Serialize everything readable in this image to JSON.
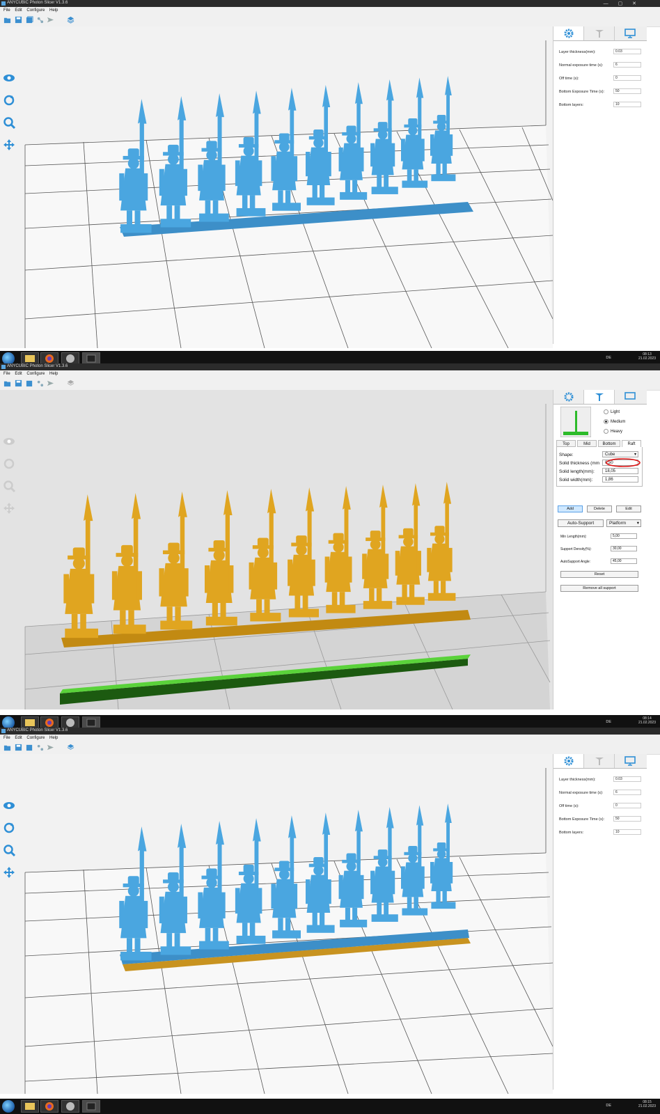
{
  "app": {
    "title": "ANYCUBIC Photon Slicer V1.3.6",
    "menus": [
      "File",
      "Edit",
      "Configure",
      "Help"
    ]
  },
  "panel1": {
    "settings": [
      {
        "label": "Layer thickness(mm):",
        "value": "0.03"
      },
      {
        "label": "Normal exposure time (s):",
        "value": "6"
      },
      {
        "label": "Off time (s):",
        "value": "0"
      },
      {
        "label": "Bottom Exposure Time (s):",
        "value": "50"
      },
      {
        "label": "Bottom layers:",
        "value": "10"
      }
    ]
  },
  "panel2": {
    "density": [
      "Light",
      "Medium",
      "Heavy"
    ],
    "tabs": [
      "Top",
      "Mid",
      "Bottom",
      "Raft"
    ],
    "shape_label": "Shape:",
    "shape_value": "Cube",
    "solid_thickness_label": "Solid thickness (mm",
    "solid_thickness_value": "0,50",
    "solid_length_label": "Solid length(mm):",
    "solid_length_value": "18,05",
    "solid_width_label": "Solid width(mm):",
    "solid_width_value": "1,86",
    "add": "Add",
    "delete": "Delete",
    "edit": "Edit",
    "auto_support": "Auto-Support",
    "platform": "Platform",
    "min_length_label": "Min Length(mm):",
    "min_length_value": "5,00",
    "support_density_label": "Support Density(%):",
    "support_density_value": "30,00",
    "autosupport_angle_label": "AutoSupport Angle:",
    "autosupport_angle_value": "45,00",
    "reset": "Reset",
    "remove_all": "Remove all support"
  },
  "taskbars": [
    {
      "lang": "DE",
      "time": "08:13",
      "date": "21.02.2023"
    },
    {
      "lang": "DE",
      "time": "08:14",
      "date": "21.02.2023"
    },
    {
      "lang": "DE",
      "time": "08:15",
      "date": "21.02.2023"
    }
  ],
  "colors": {
    "model_blue": "#4aa6e0",
    "model_gold": "#e0a520",
    "raft_green": "#5ad23a",
    "accent": "#2e8fd6"
  }
}
